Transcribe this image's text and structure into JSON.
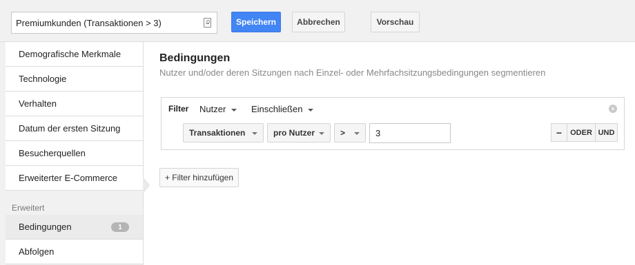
{
  "toolbar": {
    "segment_name": "Premiumkunden (Transaktionen > 3)",
    "save_label": "Speichern",
    "cancel_label": "Abbrechen",
    "preview_label": "Vorschau"
  },
  "sidebar": {
    "items": [
      {
        "label": "Demografische Merkmale"
      },
      {
        "label": "Technologie"
      },
      {
        "label": "Verhalten"
      },
      {
        "label": "Datum der ersten Sitzung"
      },
      {
        "label": "Besucherquellen"
      },
      {
        "label": "Erweiterter E-Commerce"
      }
    ],
    "advanced_heading": "Erweitert",
    "advanced_items": [
      {
        "label": "Bedingungen",
        "badge": "1"
      },
      {
        "label": "Abfolgen"
      }
    ]
  },
  "main": {
    "title": "Bedingungen",
    "subtitle": "Nutzer und/oder deren Sitzungen nach Einzel- oder Mehrfachsitzungsbedingungen segmentieren",
    "filter": {
      "label": "Filter",
      "scope": "Nutzer",
      "mode": "Einschließen",
      "dimension": "Transaktionen",
      "per": "pro Nutzer",
      "operator": ">",
      "value": "3",
      "minus_label": "−",
      "or_label": "ODER",
      "and_label": "UND"
    },
    "add_filter_label": "+ Filter hinzufügen"
  },
  "colors": {
    "primary": "#4285f4",
    "sidebar_bg": "#f1f1f1",
    "border": "#dcdcdc",
    "subtitle": "#888888"
  },
  "icons": {
    "name_input_icon": "contact-card-icon",
    "remove_filter_icon": "close-circle-icon",
    "dropdown_icon": "chevron-down-icon"
  }
}
